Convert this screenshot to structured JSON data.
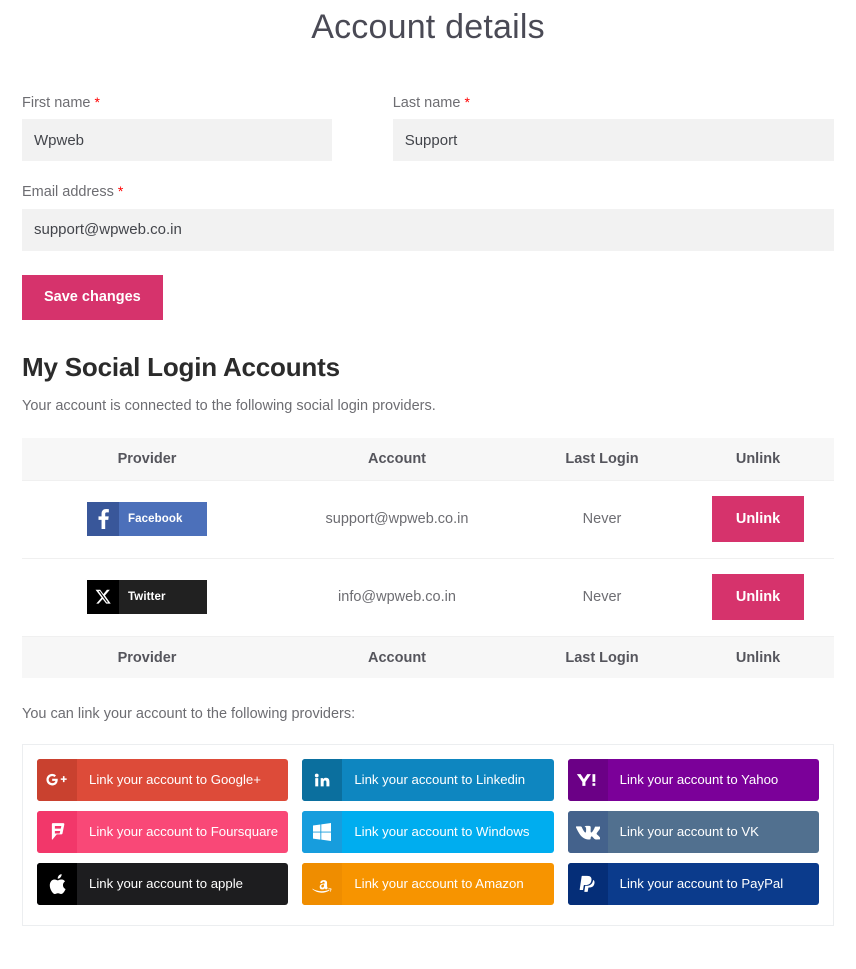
{
  "page": {
    "title": "Account details"
  },
  "form": {
    "first_name": {
      "label": "First name",
      "required_mark": "*",
      "value": "Wpweb",
      "placeholder": "First name"
    },
    "last_name": {
      "label": "Last name",
      "required_mark": "*",
      "value": "Support",
      "placeholder": "Last name"
    },
    "email": {
      "label": "Email address",
      "required_mark": "*",
      "value": "support@wpweb.co.in",
      "placeholder": "Email address"
    },
    "save_label": "Save changes",
    "save_color": "#d6336c"
  },
  "social": {
    "heading": "My Social Login Accounts",
    "subtitle": "Your account is connected to the following social login providers.",
    "columns": [
      "Provider",
      "Account",
      "Last Login",
      "Unlink"
    ],
    "rows": [
      {
        "provider_name": "Facebook",
        "provider_icon": "facebook-icon",
        "icon_color": "#39579a",
        "label_color": "#4c70ba",
        "account": "support@wpweb.co.in",
        "last_login": "Never",
        "unlink_label": "Unlink"
      },
      {
        "provider_name": "Twitter",
        "provider_icon": "twitter-x-icon",
        "icon_color": "#000000",
        "label_color": "#212121",
        "account": "info@wpweb.co.in",
        "last_login": "Never",
        "unlink_label": "Unlink"
      }
    ],
    "unlink_color": "#d6336c"
  },
  "link_providers": {
    "intro": "You can link your account to the following providers:",
    "buttons": [
      {
        "label": "Link your account to Google+",
        "icon": "google-plus-icon",
        "body_color": "#dd4b39",
        "icon_color": "#c9412f"
      },
      {
        "label": "Link your account to Linkedin",
        "icon": "linkedin-icon",
        "body_color": "#0e86c0",
        "icon_color": "#0b6f9e"
      },
      {
        "label": "Link your account to Yahoo",
        "icon": "yahoo-icon",
        "body_color": "#7b0099",
        "icon_color": "#6b0086"
      },
      {
        "label": "Link your account to Foursquare",
        "icon": "foursquare-icon",
        "body_color": "#f94877",
        "icon_color": "#f2376a"
      },
      {
        "label": "Link your account to Windows",
        "icon": "windows-icon",
        "body_color": "#00adef",
        "icon_color": "#179ddd"
      },
      {
        "label": "Link your account to VK",
        "icon": "vk-icon",
        "body_color": "#51708f",
        "icon_color": "#44628c"
      },
      {
        "label": "Link your account to apple",
        "icon": "apple-icon",
        "body_color": "#1d1d1f",
        "icon_color": "#000000"
      },
      {
        "label": "Link your account to Amazon",
        "icon": "amazon-icon",
        "body_color": "#f79400",
        "icon_color": "#ef8d00"
      },
      {
        "label": "Link your account to PayPal",
        "icon": "paypal-icon",
        "body_color": "#0b3b8c",
        "icon_color": "#052e78"
      }
    ]
  }
}
